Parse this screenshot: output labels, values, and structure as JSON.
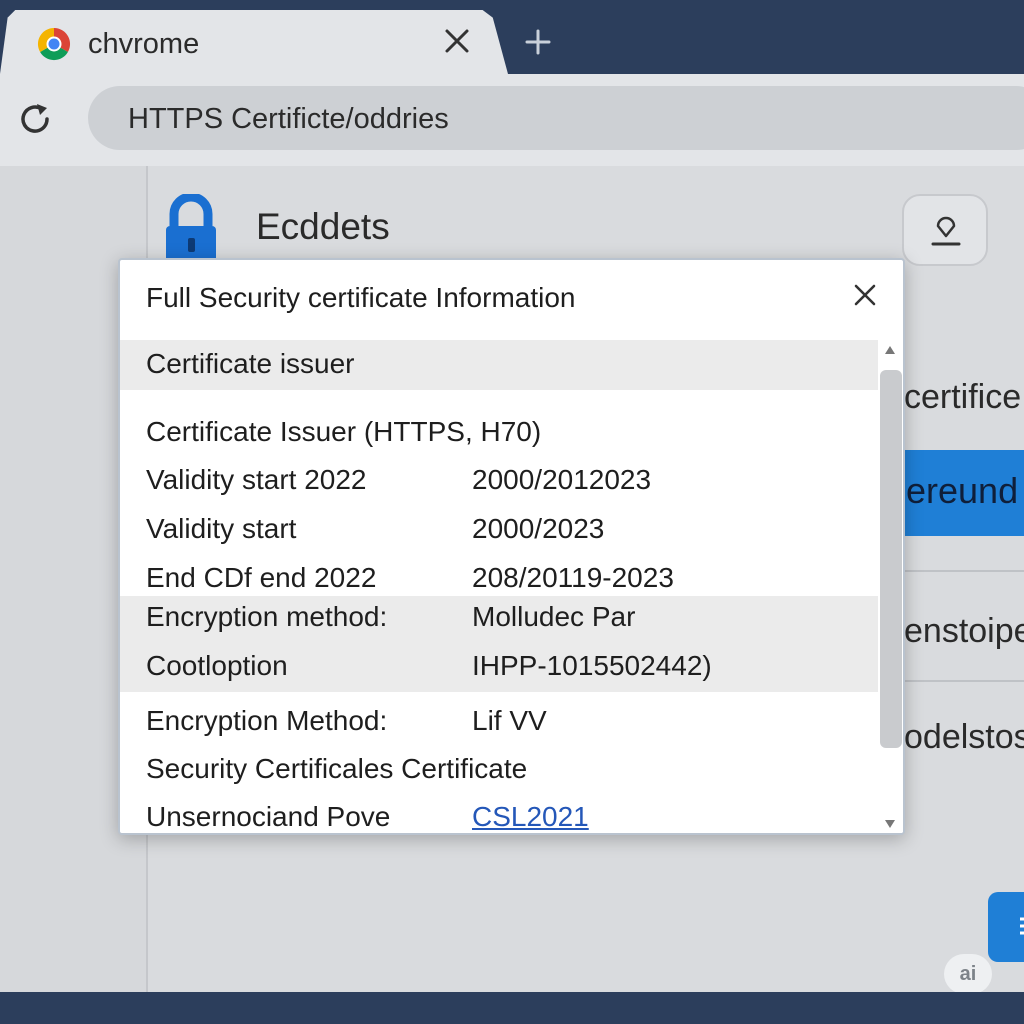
{
  "browser": {
    "tab": {
      "title": "chvrome"
    },
    "address_bar": {
      "text": "HTTPS Certificte/oddries"
    }
  },
  "page": {
    "heading": "Ecddets",
    "background_items": [
      "certifice",
      "ereund",
      "enstoipe",
      "odelstos"
    ]
  },
  "dialog": {
    "title": "Full Security certificate Information",
    "section_header": "Certificate issuer",
    "rows": [
      {
        "label": "Certificate Issuer (HTTPS, H70)",
        "value": ""
      },
      {
        "label": "Validity start 2022",
        "value": "2000/2012023"
      },
      {
        "label": "Validity start",
        "value": "2000/2023"
      },
      {
        "label": "End CDf end 2022",
        "value": "208/20119-2023"
      },
      {
        "label": "Encryption method:",
        "value": "Molludec Par"
      },
      {
        "label": "Cootloption",
        "value": "IHPP-1015502442)"
      },
      {
        "label": "Encryption Method:",
        "value": "Lif VV"
      },
      {
        "label": "Security Certificales Certificate",
        "value": ""
      },
      {
        "label": "Unsernociand Pove",
        "value": "CSL2021"
      }
    ]
  },
  "badge": {
    "text": "ai"
  },
  "icons": {
    "browser_logo": "chrome-logo-icon",
    "tab_close": "close-icon",
    "new_tab": "plus-icon",
    "reload": "reload-icon",
    "lock": "lock-icon",
    "download": "download-icon",
    "dialog_close": "close-icon",
    "scroll_up": "triangle-up-icon",
    "scroll_down": "triangle-down-icon",
    "menu": "menu-icon"
  },
  "colors": {
    "frame": "#2c3e5c",
    "accent_blue": "#1f7fd6",
    "link": "#2457b8",
    "lock_blue": "#1a6fd1"
  }
}
